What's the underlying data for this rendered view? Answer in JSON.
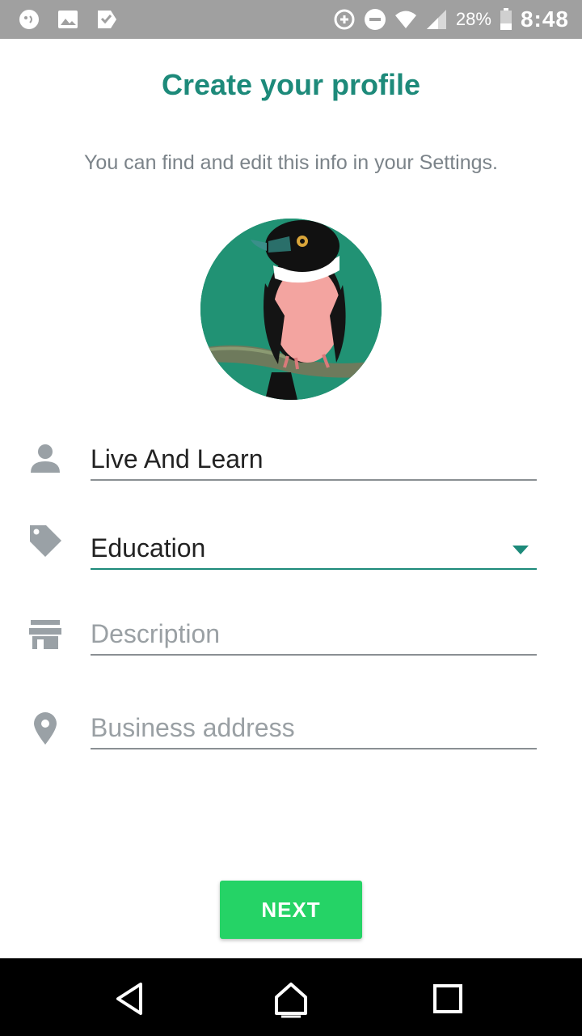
{
  "status_bar": {
    "left_icons": [
      "chat-bubble-icon",
      "image-icon",
      "check-tag-icon"
    ],
    "right_icons": [
      "data-saver-icon",
      "do-not-disturb-icon",
      "wifi-icon",
      "signal-icon",
      "battery-icon"
    ],
    "battery": "28%",
    "time": "8:48"
  },
  "header": {
    "title": "Create your profile",
    "subtitle": "You can find and edit this info in your Settings."
  },
  "profile": {
    "avatar_icon": "bird-photo"
  },
  "form": {
    "name_value": "Live And Learn",
    "category_value": "Education",
    "description_placeholder": "Description",
    "address_placeholder": "Business address"
  },
  "actions": {
    "next_label": "NEXT"
  },
  "colors": {
    "accent": "#1d8a7a",
    "button": "#25d366",
    "status_bar": "#a0a0a0"
  },
  "nav_bar": {
    "icons": [
      "back-icon",
      "home-icon",
      "recents-icon"
    ]
  }
}
